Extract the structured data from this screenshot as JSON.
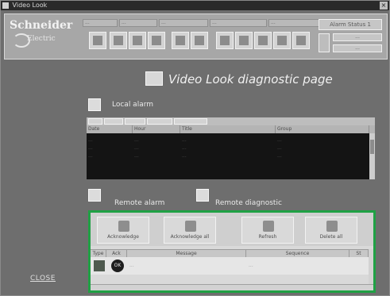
{
  "window": {
    "title": "Video Look"
  },
  "brand": {
    "name": "Schneider",
    "sub": "Electric"
  },
  "status_bar": [
    "...",
    "...",
    "...",
    "...",
    "..."
  ],
  "right_panel": {
    "alarm_button": "Alarm Status 1",
    "time_label": "...",
    "date_label": "..."
  },
  "page": {
    "title": "Video Look diagnostic page"
  },
  "local_alarm": {
    "label": "Local alarm",
    "tabs": [
      "",
      "",
      "",
      "",
      ""
    ],
    "columns": [
      "Date",
      "Hour",
      "Title",
      "Group"
    ],
    "rows": [
      [
        "...",
        "...",
        "...",
        "..."
      ],
      [
        "...",
        "...",
        "...",
        "..."
      ],
      [
        "...",
        "...",
        "...",
        "..."
      ]
    ]
  },
  "remote": {
    "alarm_label": "Remote alarm",
    "diagnostic_label": "Remote diagnostic",
    "buttons": [
      "Acknowledge",
      "Acknowledge all",
      "Refresh",
      "Delete all"
    ],
    "columns": [
      "Type",
      "Ack",
      "Message",
      "Sequence",
      "St"
    ],
    "row": {
      "message": "...",
      "sequence": "..."
    }
  },
  "close_label": "CLOSE",
  "colors": {
    "highlight": "#1fa144"
  }
}
